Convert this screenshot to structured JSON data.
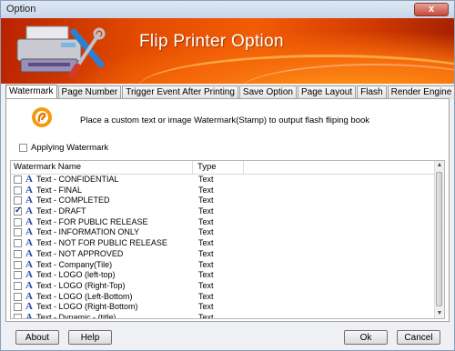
{
  "window": {
    "title": "Option",
    "close_glyph": "x"
  },
  "banner": {
    "title": "Flip Printer Option"
  },
  "tabs": [
    {
      "label": "Watermark"
    },
    {
      "label": "Page Number"
    },
    {
      "label": "Trigger Event After Printing"
    },
    {
      "label": "Save Option"
    },
    {
      "label": "Page Layout"
    },
    {
      "label": "Flash"
    },
    {
      "label": "Render Engine"
    }
  ],
  "watermark": {
    "description": "Place a custom text or image Watermark(Stamp) to output flash fliping book",
    "apply_label": "Applying Watermark",
    "apply_checked": false,
    "columns": {
      "name": "Watermark Name",
      "type": "Type"
    },
    "items": [
      {
        "name": "Text - CONFIDENTIAL",
        "type": "Text",
        "checked": false
      },
      {
        "name": "Text - FINAL",
        "type": "Text",
        "checked": false
      },
      {
        "name": "Text - COMPLETED",
        "type": "Text",
        "checked": false
      },
      {
        "name": "Text - DRAFT",
        "type": "Text",
        "checked": true
      },
      {
        "name": "Text - FOR PUBLIC RELEASE",
        "type": "Text",
        "checked": false
      },
      {
        "name": "Text - INFORMATION ONLY",
        "type": "Text",
        "checked": false
      },
      {
        "name": "Text - NOT FOR PUBLIC RELEASE",
        "type": "Text",
        "checked": false
      },
      {
        "name": "Text - NOT APPROVED",
        "type": "Text",
        "checked": false
      },
      {
        "name": "Text - Company(Tile)",
        "type": "Text",
        "checked": false
      },
      {
        "name": "Text - LOGO (left-top)",
        "type": "Text",
        "checked": false
      },
      {
        "name": "Text - LOGO (Right-Top)",
        "type": "Text",
        "checked": false
      },
      {
        "name": "Text - LOGO (Left-Bottom)",
        "type": "Text",
        "checked": false
      },
      {
        "name": "Text - LOGO (Right-Bottom)",
        "type": "Text",
        "checked": false
      },
      {
        "name": "Text - Dynamic - (title)",
        "type": "Text",
        "checked": false
      }
    ]
  },
  "buttons": {
    "about": "About",
    "help": "Help",
    "ok": "Ok",
    "cancel": "Cancel"
  },
  "colors": {
    "banner_orange": "#f35c05",
    "icon_blue": "#2a4aa8"
  }
}
